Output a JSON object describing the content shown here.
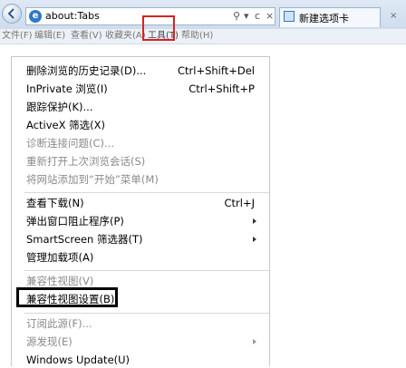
{
  "address_bar": {
    "url": "about:Tabs",
    "search_icon": "search-icon",
    "controls": [
      "▾",
      "c",
      "×"
    ]
  },
  "tab": {
    "title": "新建选项卡",
    "close": "×"
  },
  "menubar": {
    "items": [
      "文件(F)",
      "编辑(E)",
      "查看(V)",
      "收藏夹(A)",
      "工具(T)",
      "帮助(H)"
    ]
  },
  "menu": {
    "items": [
      {
        "label": "删除浏览的历史记录(D)...",
        "shortcut": "Ctrl+Shift+Del",
        "disabled": false
      },
      {
        "label": "InPrivate 浏览(I)",
        "shortcut": "Ctrl+Shift+P",
        "disabled": false
      },
      {
        "label": "跟踪保护(K)...",
        "shortcut": "",
        "disabled": false
      },
      {
        "label": "ActiveX 筛选(X)",
        "shortcut": "",
        "disabled": false
      },
      {
        "label": "诊断连接问题(C)...",
        "shortcut": "",
        "disabled": true
      },
      {
        "label": "重新打开上次浏览会话(S)",
        "shortcut": "",
        "disabled": true
      },
      {
        "label": "将网站添加到“开始”菜单(M)",
        "shortcut": "",
        "disabled": true
      },
      {
        "label": "查看下载(N)",
        "shortcut": "Ctrl+J",
        "disabled": false
      },
      {
        "label": "弹出窗口阻止程序(P)",
        "shortcut": "",
        "disabled": false,
        "submenu": true
      },
      {
        "label": "SmartScreen 筛选器(T)",
        "shortcut": "",
        "disabled": false,
        "submenu": true
      },
      {
        "label": "管理加载项(A)",
        "shortcut": "",
        "disabled": false
      },
      {
        "label": "兼容性视图(V)",
        "shortcut": "",
        "disabled": true
      },
      {
        "label": "兼容性视图设置(B)",
        "shortcut": "",
        "disabled": false
      },
      {
        "label": "订阅此源(F)...",
        "shortcut": "",
        "disabled": true
      },
      {
        "label": "源发现(E)",
        "shortcut": "",
        "disabled": true,
        "submenu": true
      },
      {
        "label": "Windows Update(U)",
        "shortcut": "",
        "disabled": false
      }
    ]
  },
  "colors": {
    "highlight_tools": "#d62222",
    "highlight_selected": "#000000",
    "disabled_text": "#8a8a8a"
  }
}
